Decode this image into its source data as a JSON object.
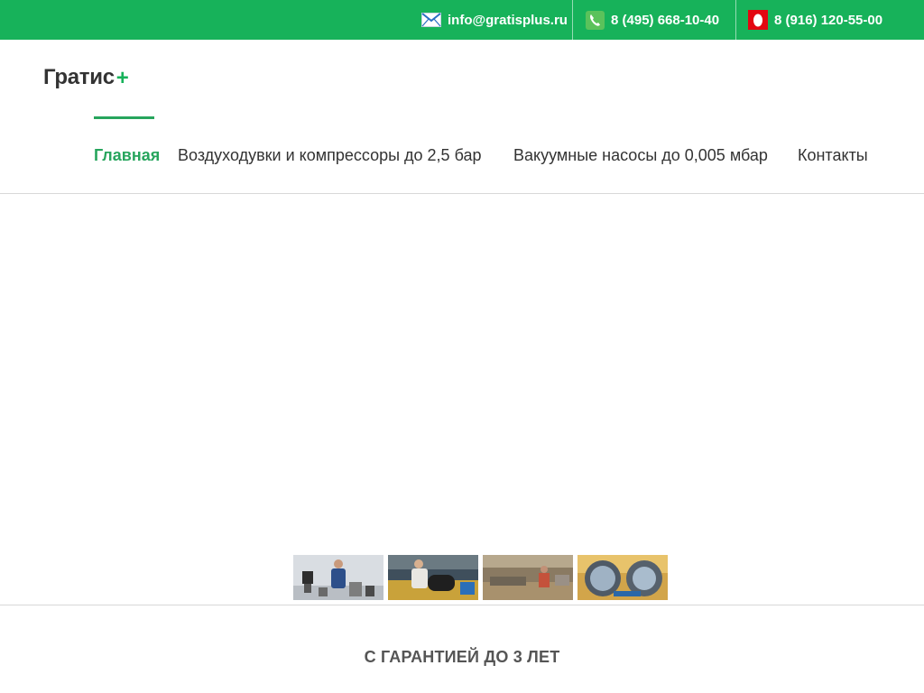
{
  "topbar": {
    "email": {
      "icon": "mail-icon",
      "text": "info@gratisplus.ru"
    },
    "phone_landline": {
      "icon": "phone-icon",
      "text": "8 (495) 668-10-40"
    },
    "phone_mobile": {
      "icon": "mts-icon",
      "text": "8 (916) 120-55-00"
    },
    "accent_color": "#17b25a"
  },
  "logo": {
    "text": "Гратис",
    "plus": "+"
  },
  "nav": {
    "items": [
      {
        "label": "Главная",
        "active": true
      },
      {
        "label": "Воздуходувки и компрессоры до 2,5 бар",
        "active": false
      },
      {
        "label": "Вакуумные насосы до 0,005 мбар",
        "active": false
      },
      {
        "label": "Контакты",
        "active": false
      }
    ],
    "active_color": "#27a55d"
  },
  "slider": {
    "thumbnails": [
      {
        "name": "thumbnail-presenter"
      },
      {
        "name": "thumbnail-worker"
      },
      {
        "name": "thumbnail-workshop"
      },
      {
        "name": "thumbnail-blower-housing"
      }
    ]
  },
  "guarantee": {
    "text": "С ГАРАНТИЕЙ ДО 3 ЛЕТ"
  }
}
